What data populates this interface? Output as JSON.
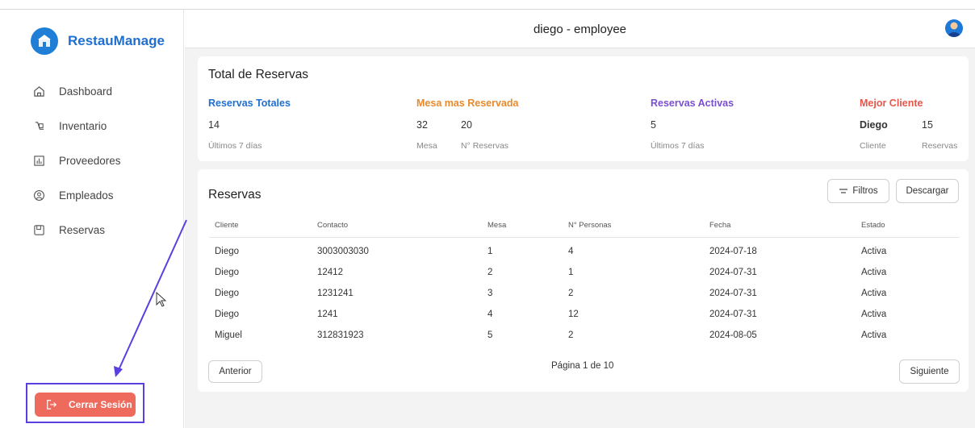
{
  "app": {
    "brand": "RestauManage",
    "user_title": "diego - employee"
  },
  "sidebar": {
    "items": [
      {
        "label": "Dashboard",
        "icon": "home-icon"
      },
      {
        "label": "Inventario",
        "icon": "inventory-icon"
      },
      {
        "label": "Proveedores",
        "icon": "chart-icon"
      },
      {
        "label": "Empleados",
        "icon": "user-icon"
      },
      {
        "label": "Reservas",
        "icon": "book-icon"
      }
    ],
    "logout_label": "Cerrar Sesión"
  },
  "summary": {
    "title": "Total de Reservas",
    "total": {
      "label": "Reservas Totales",
      "value": "14",
      "sub": "Últimos 7 días"
    },
    "mesa": {
      "label": "Mesa mas Reservada",
      "mesa_value": "32",
      "reservas_value": "20",
      "mesa_sub": "Mesa",
      "reservas_sub": "N° Reservas"
    },
    "activas": {
      "label": "Reservas Activas",
      "value": "5",
      "sub": "Últimos 7 días"
    },
    "cliente": {
      "label": "Mejor Cliente",
      "name": "Diego",
      "count": "15",
      "name_sub": "Cliente",
      "count_sub": "Reservas"
    }
  },
  "reservas": {
    "title": "Reservas",
    "filter_label": "Filtros",
    "download_label": "Descargar",
    "columns": [
      "Cliente",
      "Contacto",
      "Mesa",
      "N° Personas",
      "Fecha",
      "Estado"
    ],
    "rows": [
      [
        "Diego",
        "3003003030",
        "1",
        "4",
        "2024-07-18",
        "Activa"
      ],
      [
        "Diego",
        "12412",
        "2",
        "1",
        "2024-07-31",
        "Activa"
      ],
      [
        "Diego",
        "1231241",
        "3",
        "2",
        "2024-07-31",
        "Activa"
      ],
      [
        "Diego",
        "1241",
        "4",
        "12",
        "2024-07-31",
        "Activa"
      ],
      [
        "Miguel",
        "312831923",
        "5",
        "2",
        "2024-08-05",
        "Activa"
      ]
    ],
    "prev_label": "Anterior",
    "next_label": "Siguiente",
    "page_info": "Página 1 de 10"
  },
  "colors": {
    "blue": "#1f6fd1",
    "orange": "#e88a2e",
    "purple": "#7a4fd0",
    "red": "#e8554a",
    "logout": "#ee6a5c",
    "annotation": "#5b3ee0"
  }
}
